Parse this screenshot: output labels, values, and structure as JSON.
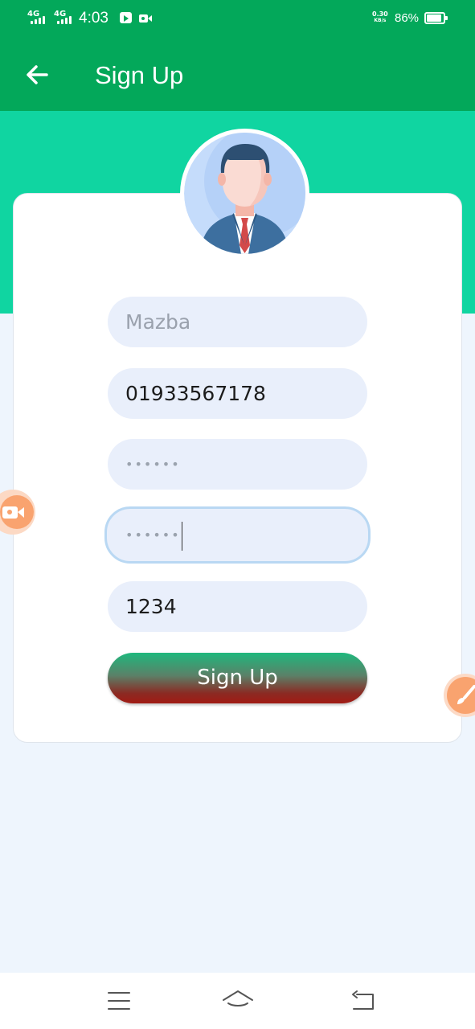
{
  "status_bar": {
    "network1": "4G",
    "network2": "4G",
    "time": "4:03",
    "speed_value": "0.30",
    "speed_unit": "KB/s",
    "battery": "86%"
  },
  "app_bar": {
    "title": "Sign Up"
  },
  "form": {
    "name_placeholder": "Mazba",
    "phone_value": "01933567178",
    "password_value": "••••••",
    "confirm_password_value": "••••••",
    "code_value": "1234",
    "submit_label": "Sign Up"
  },
  "colors": {
    "app_bar": "#03a85a",
    "header_band": "#10d5a1",
    "background": "#eef5fd",
    "input_fill": "#e9effb",
    "focus_border": "#b9d8f3",
    "float_buttons": "#f9a36f"
  },
  "icons": {
    "back": "arrow-left-icon",
    "avatar": "businessman-avatar",
    "left_float": "video-camera-icon",
    "right_float": "paint-brush-icon",
    "nav_menu": "hamburger-icon",
    "nav_home": "home-icon",
    "nav_back": "return-icon"
  }
}
